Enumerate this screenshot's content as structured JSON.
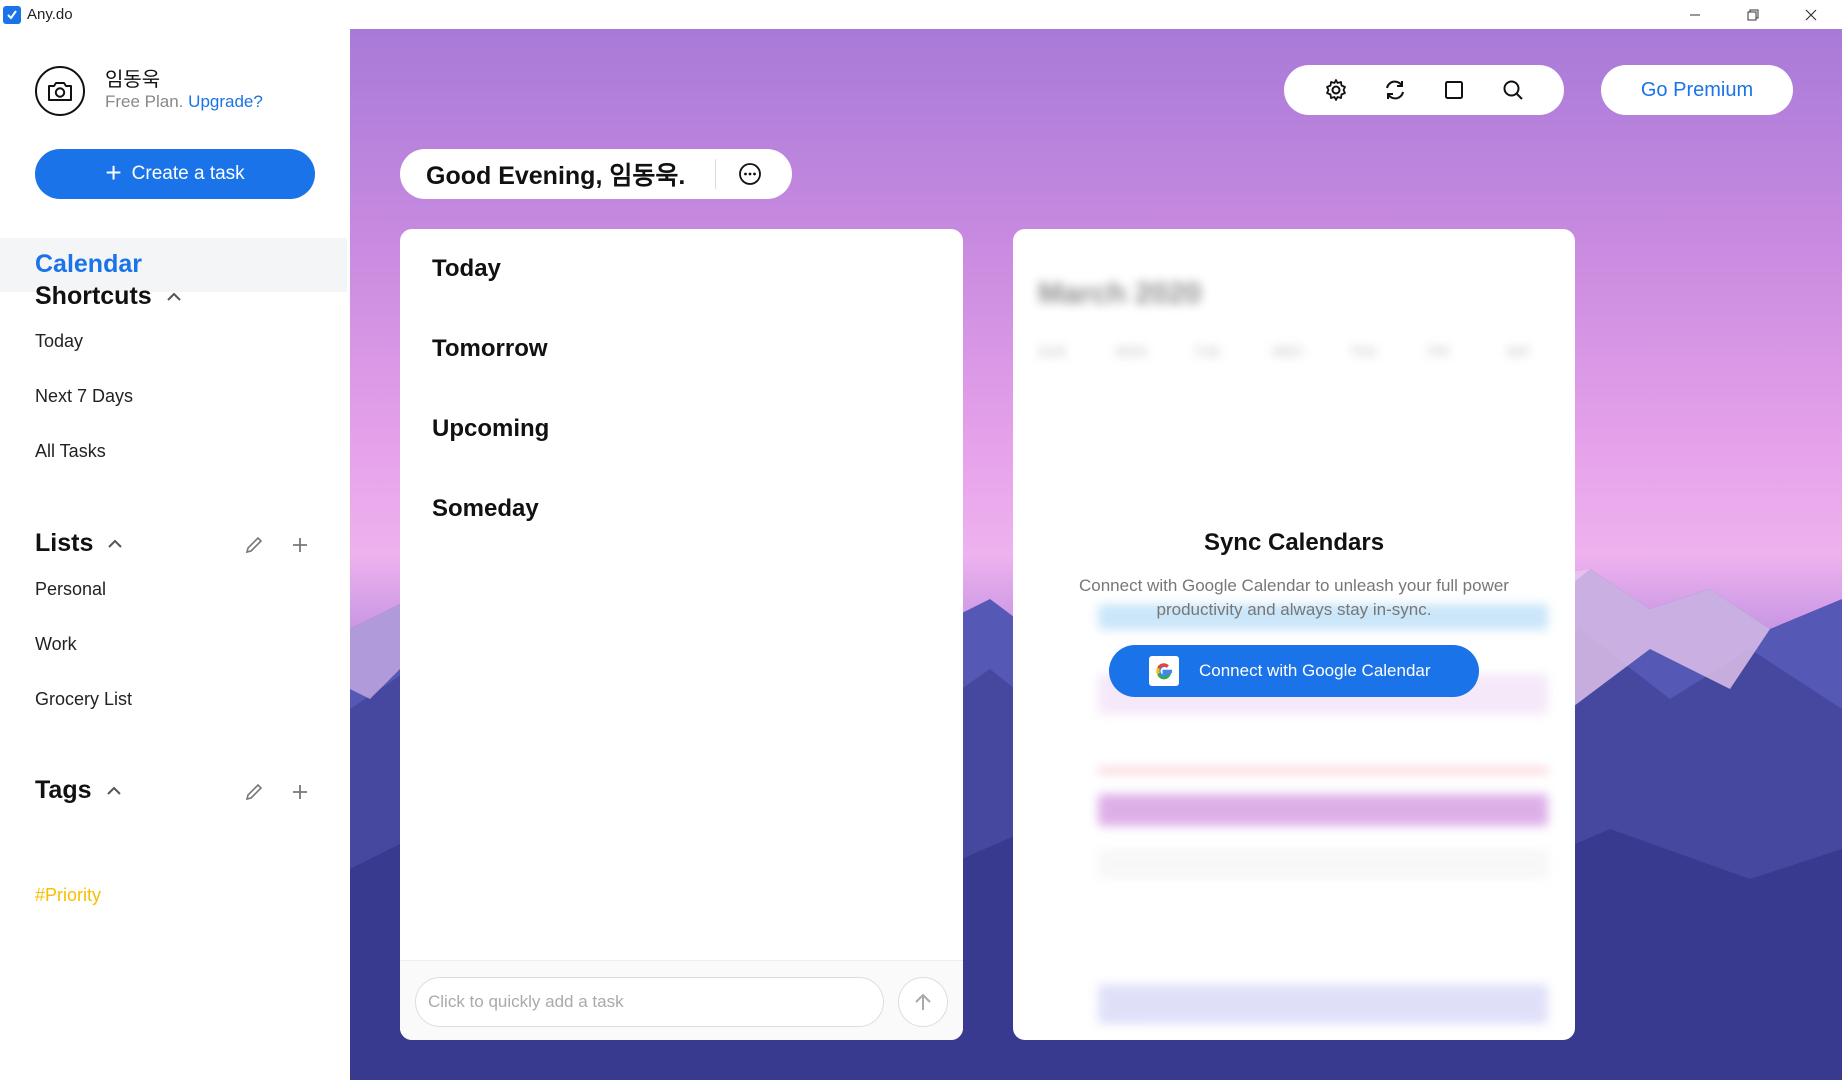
{
  "window": {
    "title": "Any.do"
  },
  "sidebar": {
    "user_name": "임동욱",
    "plan_text": "Free Plan.",
    "upgrade_label": "Upgrade?",
    "create_task_label": "Create a task",
    "calendar_label": "Calendar",
    "shortcuts": {
      "title": "Shortcuts",
      "items": [
        "Today",
        "Next 7 Days",
        "All Tasks"
      ]
    },
    "lists": {
      "title": "Lists",
      "items": [
        "Personal",
        "Work",
        "Grocery List"
      ]
    },
    "tags": {
      "title": "Tags",
      "items": [
        "#Priority"
      ]
    }
  },
  "main": {
    "greeting": "Good Evening, 임동욱.",
    "premium_label": "Go Premium",
    "toolbar_icons": [
      "gear-icon",
      "sync-icon",
      "square-icon",
      "search-icon"
    ],
    "task_groups": [
      "Today",
      "Tomorrow",
      "Upcoming",
      "Someday"
    ],
    "quick_add_placeholder": "Click to quickly add a task",
    "calendar": {
      "month_title": "March 2020",
      "weekdays": [
        "SUN",
        "MON",
        "TUE",
        "WED",
        "THU",
        "FRI",
        "SAT"
      ],
      "sync_title": "Sync Calendars",
      "sync_description": "Connect with Google Calendar to unleash your full power productivity and always stay in-sync.",
      "connect_label": "Connect with Google Calendar"
    }
  },
  "colors": {
    "accent": "#1a73e8",
    "tag": "#f5c000"
  }
}
